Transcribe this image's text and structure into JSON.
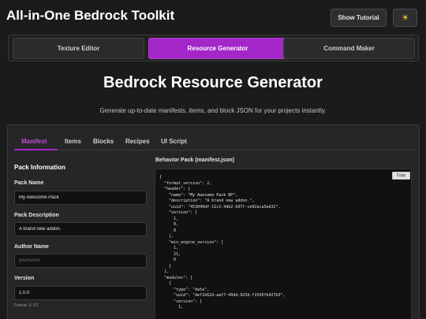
{
  "app": {
    "title": "All-in-One Bedrock Toolkit",
    "tutorial_label": "Show Tutorial",
    "theme_icon": "sun-icon"
  },
  "tool_tabs": [
    {
      "label": "Texture Editor",
      "active": false
    },
    {
      "label": "Resource Generator",
      "active": true
    },
    {
      "label": "Command Maker",
      "active": false
    }
  ],
  "main": {
    "title": "Bedrock Resource Generator",
    "subtitle": "Generate up-to-date manifests, items, and block JSON for your projects instantly."
  },
  "tabs": [
    {
      "label": "Manifest",
      "active": true
    },
    {
      "label": "Items",
      "active": false
    },
    {
      "label": "Blocks",
      "active": false
    },
    {
      "label": "Recipes",
      "active": false
    },
    {
      "label": "UI Script",
      "active": false
    }
  ],
  "form": {
    "title": "Pack Information",
    "pack_name": {
      "label": "Pack Name",
      "value": "My Awesome Pack"
    },
    "pack_description": {
      "label": "Pack Description",
      "value": "A brand new addon."
    },
    "author_name": {
      "label": "Author Name",
      "value": "",
      "placeholder": "yourname"
    },
    "version": {
      "label": "Version",
      "value": "1.0.0",
      "hint": "Format: X.Y.Z"
    }
  },
  "output": {
    "title": "Behavior Pack (manifest.json)",
    "copy_label": "Copy",
    "code": "{\n  \"format_version\": 2,\n  \"header\": {\n    \"name\": \"My Awesome Pack BP\",\n    \"description\": \"A brand new addon.\",\n    \"uuid\": \"453049df-11c1-4db2-b97f-ce92aca5ed32\",\n    \"version\": [\n      1,\n      0,\n      0\n    ],\n    \"min_engine_version\": [\n      1,\n      21,\n      0\n    ]\n  },\n  \"modules\": [\n    {\n      \"type\": \"data\",\n      \"uuid\": \"def1b62d-aaf7-49dd-923d-f1545fb427b3\",\n      \"version\": [\n        1,"
  },
  "colors": {
    "accent": "#a327c6",
    "background": "#1b1b1b",
    "panel": "#262626"
  }
}
